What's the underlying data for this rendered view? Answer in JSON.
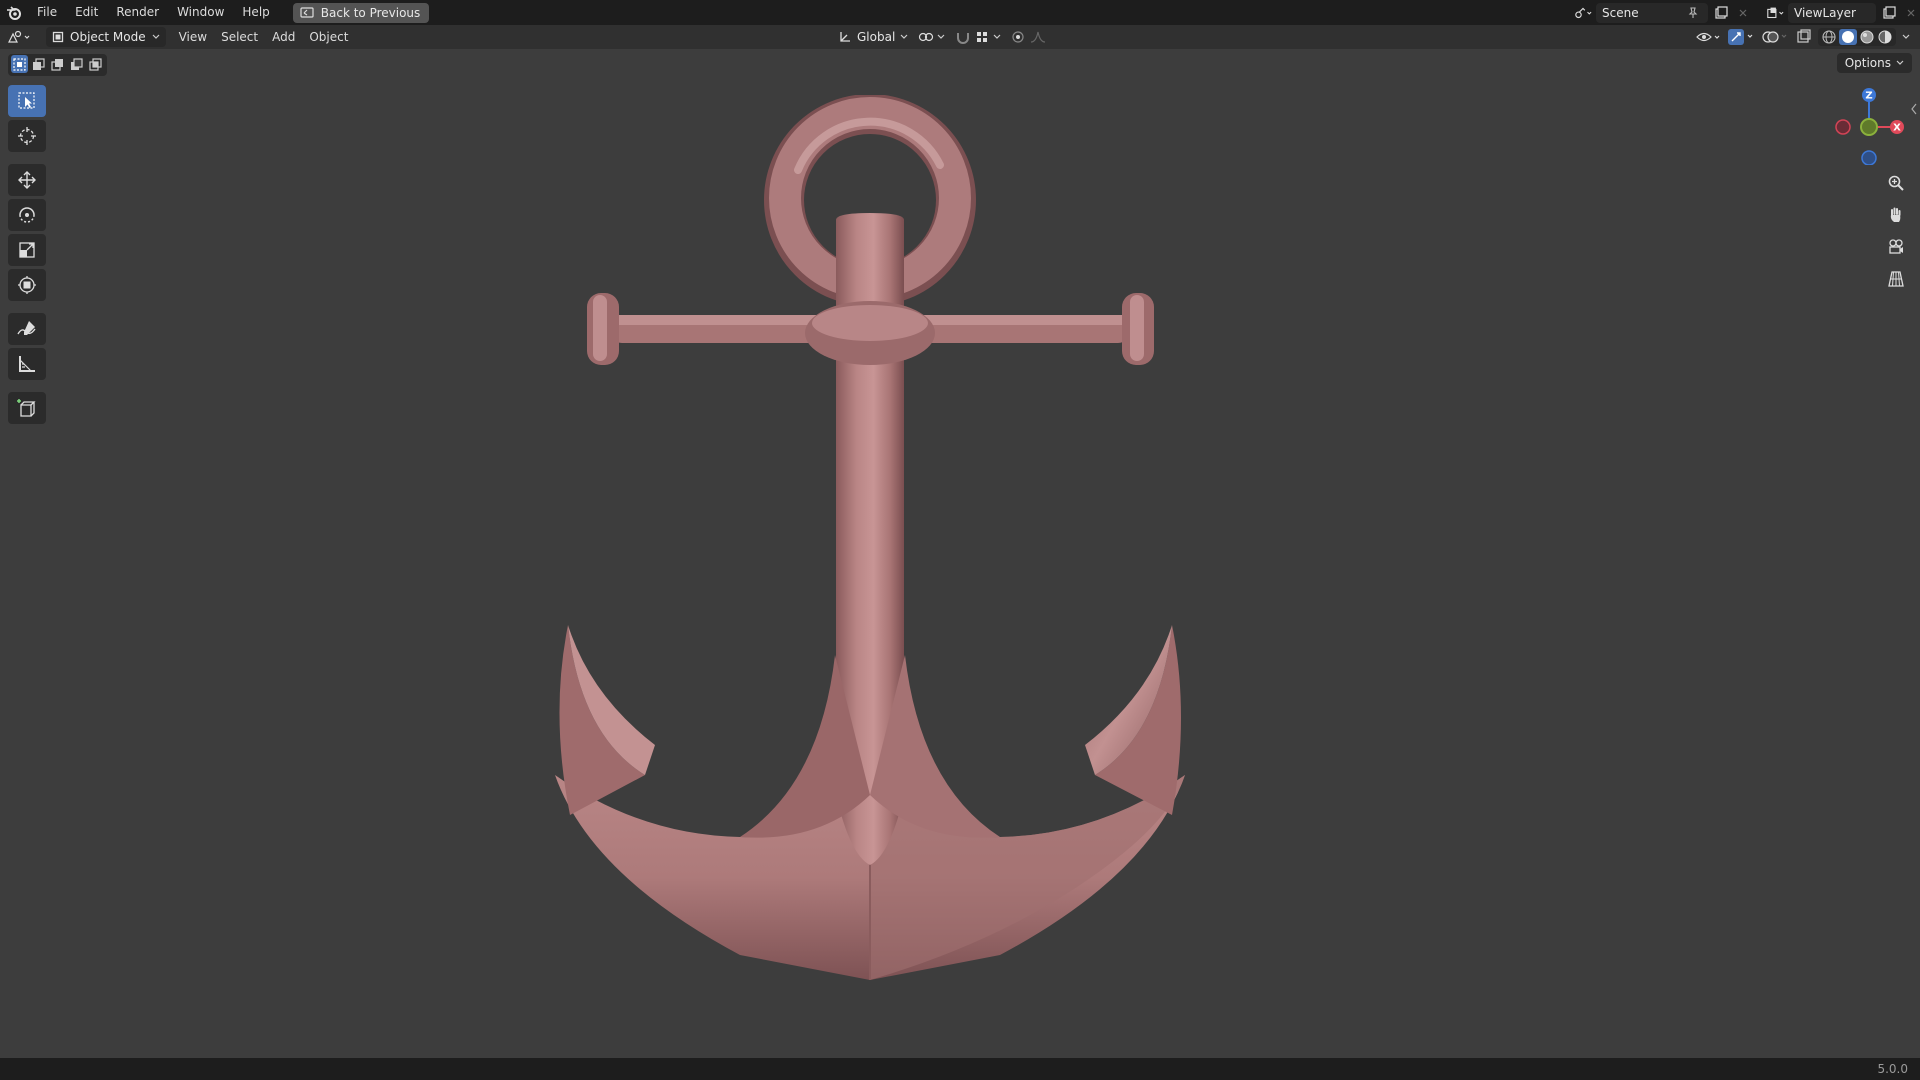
{
  "menu": {
    "items": [
      "File",
      "Edit",
      "Render",
      "Window",
      "Help"
    ],
    "back_button": "Back to Previous"
  },
  "scene": {
    "name": "Scene"
  },
  "view_layer": {
    "name": "ViewLayer"
  },
  "header": {
    "mode": "Object Mode",
    "menus": [
      "View",
      "Select",
      "Add",
      "Object"
    ],
    "transform_orientation": "Global"
  },
  "viewport": {
    "options_label": "Options",
    "gizmo": {
      "z_label": "Z",
      "x_label": "X"
    },
    "object_color": "#b88383",
    "background": "#3d3d3d",
    "accent": "#4772b3"
  },
  "toolbar": {
    "tools": [
      "select-box",
      "cursor",
      "move",
      "rotate",
      "scale",
      "transform",
      "annotate",
      "measure",
      "add-cube"
    ]
  },
  "status": {
    "version": "5.0.0"
  }
}
